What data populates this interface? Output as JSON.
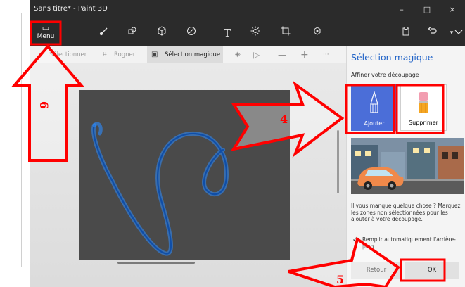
{
  "window": {
    "title": "Sans titre* - Paint 3D",
    "minimize_glyph": "–",
    "maximize_glyph": "□",
    "close_glyph": "×"
  },
  "menu": {
    "label": "Menu",
    "icon": "folder-icon"
  },
  "toolbar": {
    "tools": [
      "brush-icon",
      "shapes-2d-icon",
      "shapes-3d-icon",
      "stickers-icon",
      "text-icon",
      "effects-icon",
      "canvas-icon",
      "library-3d-icon"
    ],
    "text_tool_glyph": "T",
    "right_icons": [
      "paste-icon",
      "undo-icon",
      "chevron-down-icon"
    ]
  },
  "selection_bar": {
    "select_label": "Sélectionner",
    "crop_label": "Rogner",
    "magic_label": "Sélection magique",
    "minus_glyph": "—",
    "plus_glyph": "+",
    "more_glyph": "···"
  },
  "panel": {
    "title": "Sélection magique",
    "subtitle": "Affiner votre découpage",
    "add_label": "Ajouter",
    "remove_label": "Supprimer",
    "help_text": "Il vous manque quelque chose ? Marquez les zones non sélectionnées pour les ajouter à votre découpage.",
    "autofill_label": "Remplir automatiquement l'arrière-plan",
    "back_label": "Retour",
    "ok_label": "OK"
  },
  "annotations": {
    "step_6": "6",
    "step_4": "4",
    "step_5": "5"
  },
  "colors": {
    "highlight": "#ff0000",
    "accent": "#1f62c7",
    "add_button": "#4b6ed8",
    "stroke": "#2d8cff"
  }
}
